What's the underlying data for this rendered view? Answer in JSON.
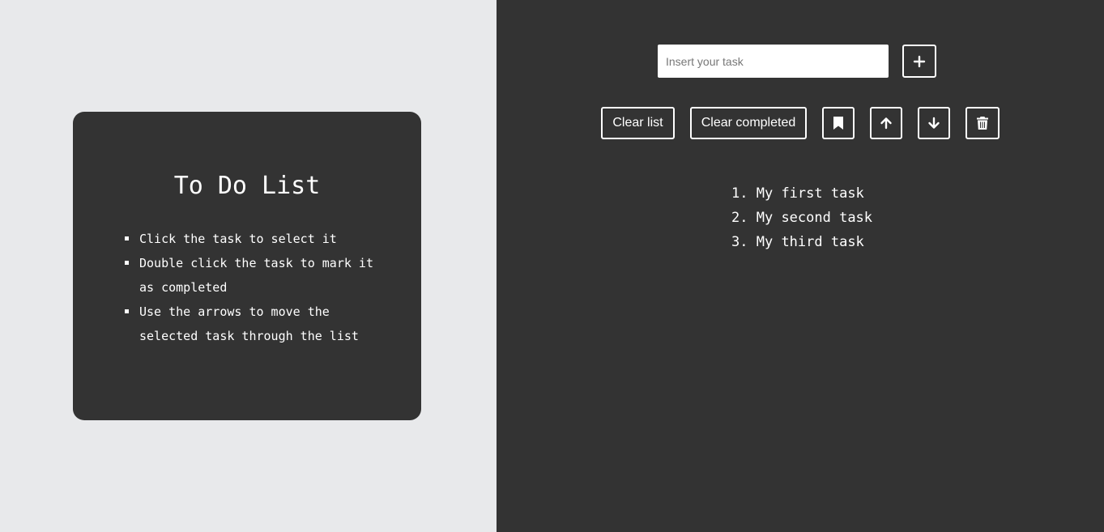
{
  "info": {
    "title": "To Do List",
    "instructions": [
      "Click the task to select it",
      "Double click the task to mark it as completed",
      "Use the arrows to move the selected task through the list"
    ]
  },
  "input": {
    "placeholder": "Insert your task",
    "value": ""
  },
  "toolbar": {
    "add_icon": "plus-icon",
    "clear_list_label": "Clear list",
    "clear_completed_label": "Clear completed",
    "bookmark_icon": "bookmark-icon",
    "up_icon": "arrow-up-icon",
    "down_icon": "arrow-down-icon",
    "trash_icon": "trash-icon"
  },
  "tasks": [
    {
      "number": "1.",
      "text": "My first task"
    },
    {
      "number": "2.",
      "text": "My second task"
    },
    {
      "number": "3.",
      "text": "My third task"
    }
  ],
  "colors": {
    "left_background": "#e8e9eb",
    "dark": "#333333",
    "text": "#ffffff"
  }
}
